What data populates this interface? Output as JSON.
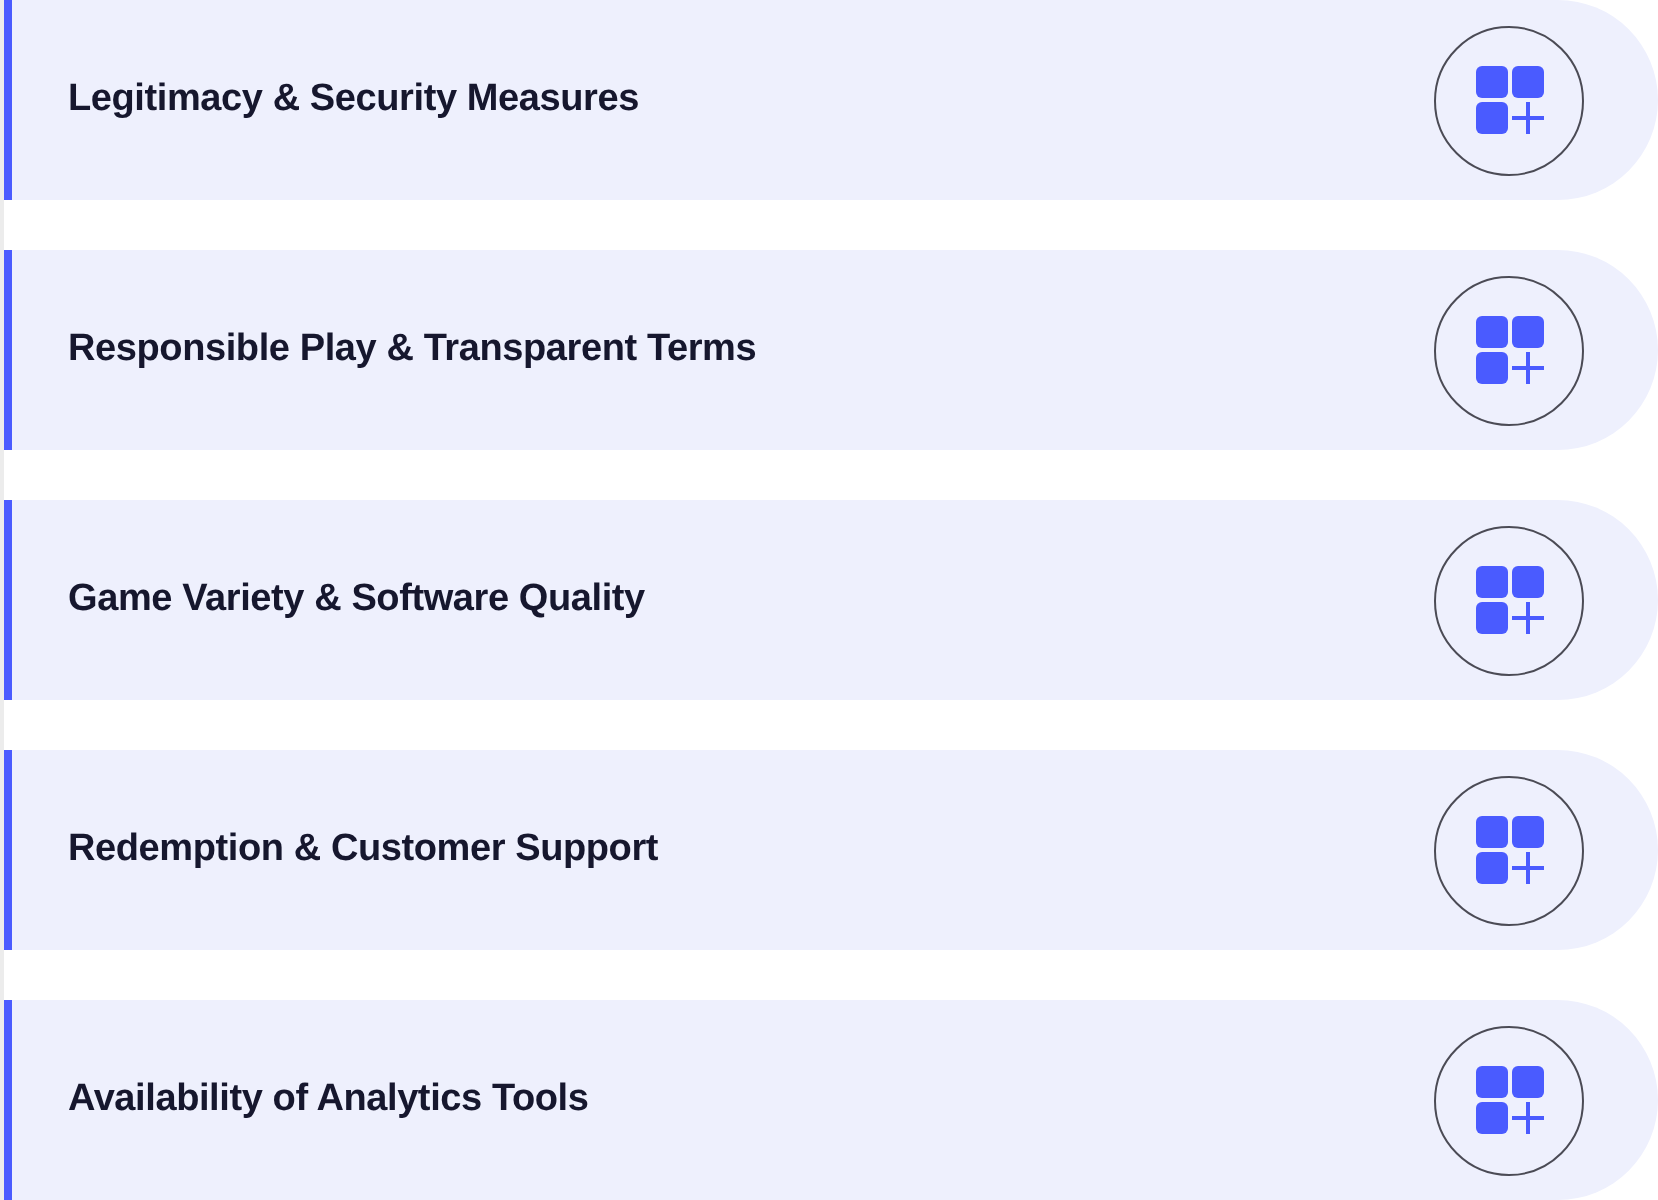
{
  "items": [
    {
      "title": "Legitimacy & Security Measures"
    },
    {
      "title": "Responsible Play & Transparent Terms"
    },
    {
      "title": "Game Variety & Software Quality"
    },
    {
      "title": "Redemption & Customer Support"
    },
    {
      "title": "Availability of Analytics Tools"
    }
  ]
}
